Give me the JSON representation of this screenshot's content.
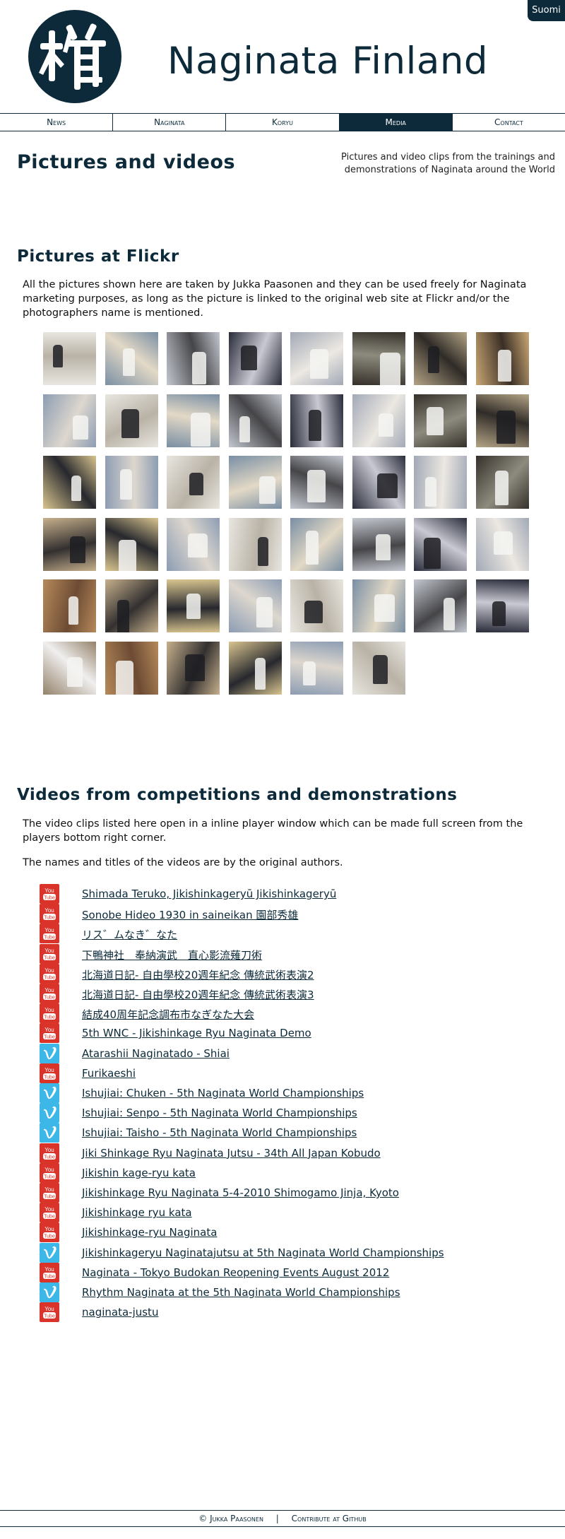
{
  "lang_link": "Suomi",
  "site_title": "Naginata Finland",
  "nav": [
    {
      "label": "News"
    },
    {
      "label": "Naginata"
    },
    {
      "label": "Koryu"
    },
    {
      "label": "Media",
      "active": true
    },
    {
      "label": "Contact"
    }
  ],
  "page": {
    "title": "Pictures and videos",
    "description": "Pictures and video clips from the trainings and demonstrations of Naginata around the World"
  },
  "flickr": {
    "heading": "Pictures at Flickr",
    "text": "All the pictures shown here are taken by Jukka Paasonen and they can be used freely for Naginata marketing purposes, as long as the picture is linked to the original web site at Flickr and/or the photographers name is mentioned.",
    "thumb_count": 46
  },
  "videos": {
    "heading": "Videos from competitions and demonstrations",
    "intro": "The video clips listed here open in a inline player window which can be made full screen from the players bottom right corner.",
    "note": "The names and titles of the videos are by the original authors.",
    "items": [
      {
        "title": "Shimada Teruko, Jikishinkageryū Jikishinkageryū",
        "source": "youtube"
      },
      {
        "title": "Sonobe Hideo 1930 in saineikan 園部秀雄",
        "source": "youtube"
      },
      {
        "title": "リス゛ムなき゛なた",
        "source": "youtube"
      },
      {
        "title": "下鴨神社　奉納演武　直心影流薙刀術",
        "source": "youtube"
      },
      {
        "title": "北海道日記- 自由學校20週年紀念 傳統武術表演2",
        "source": "youtube"
      },
      {
        "title": "北海道日記- 自由學校20週年紀念 傳統武術表演3",
        "source": "youtube"
      },
      {
        "title": "結成40周年記念調布市なぎなた大会",
        "source": "youtube"
      },
      {
        "title": "5th WNC - Jikishinkage Ryu Naginata Demo",
        "source": "youtube"
      },
      {
        "title": "Atarashii Naginatado - Shiai",
        "source": "vimeo"
      },
      {
        "title": "Furikaeshi",
        "source": "youtube"
      },
      {
        "title": "Ishujiai: Chuken - 5th Naginata World Championships",
        "source": "vimeo"
      },
      {
        "title": "Ishujiai: Senpo - 5th Naginata World Championships",
        "source": "vimeo"
      },
      {
        "title": "Ishujiai: Taisho - 5th Naginata World Championships",
        "source": "vimeo"
      },
      {
        "title": "Jiki Shinkage Ryu Naginata Jutsu - 34th All Japan Kobudo",
        "source": "youtube"
      },
      {
        "title": "Jikishin kage-ryu kata",
        "source": "youtube"
      },
      {
        "title": "Jikishinkage Ryu Naginata 5-4-2010 Shimogamo Jinja, Kyoto",
        "source": "youtube"
      },
      {
        "title": "Jikishinkage ryu kata",
        "source": "youtube"
      },
      {
        "title": "Jikishinkage-ryu Naginata",
        "source": "youtube"
      },
      {
        "title": "Jikishinkageryu Naginatajutsu at 5th Naginata World Championships",
        "source": "vimeo"
      },
      {
        "title": "Naginata - Tokyo Budokan Reopening Events August 2012",
        "source": "youtube"
      },
      {
        "title": "Rhythm Naginata at the 5th Naginata World Championships",
        "source": "vimeo"
      },
      {
        "title": "naginata-justu",
        "source": "youtube"
      }
    ]
  },
  "footer": {
    "copyright": "© Jukka Paasonen",
    "separator": "|",
    "github": "Contribute at Github"
  }
}
